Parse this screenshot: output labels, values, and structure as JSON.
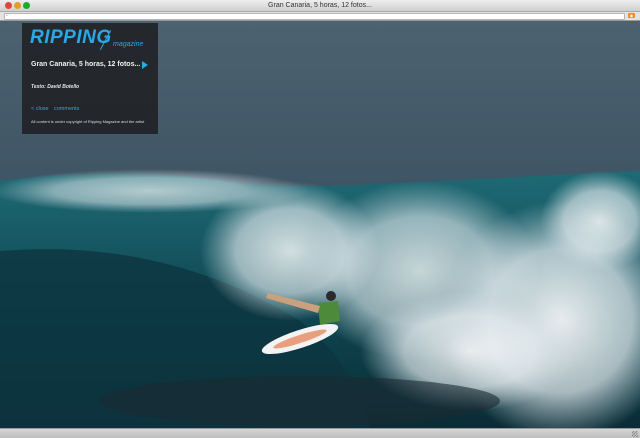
{
  "window": {
    "title": "Gran Canaria, 5 horas, 12 fotos..."
  },
  "overlay": {
    "logo": "RIPPING",
    "logo_sub": "magazine",
    "headline": "Gran Canaria, 5 horas, 12 fotos...",
    "author": "Texto: David Botello",
    "close_label": "< close",
    "comments_label": "comments",
    "copyright": "All content is under copyright of Ripping Magazine and the artist"
  },
  "icons": [
    "page-icon",
    "rss-icon",
    "play-icon",
    "resize-grip-icon"
  ],
  "colors": {
    "accent": "#29a9e6",
    "overlay_bg": "#1e1e22"
  }
}
